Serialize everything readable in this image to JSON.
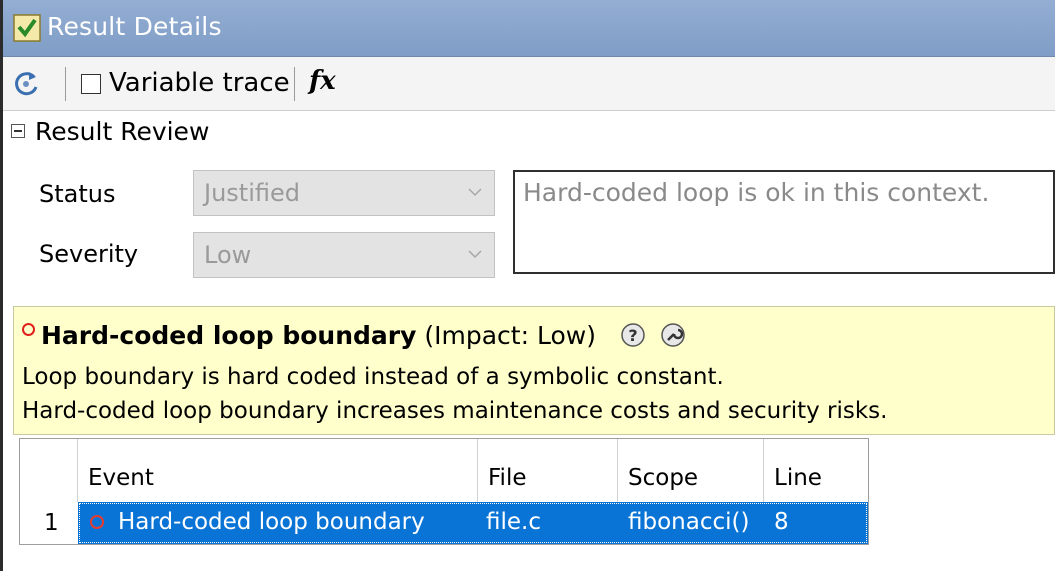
{
  "window": {
    "title": "Result Details"
  },
  "toolbar": {
    "refresh_icon": "refresh-icon",
    "variable_trace_label": "Variable trace",
    "variable_trace_checked": false,
    "fx_label": "fx"
  },
  "review": {
    "section_label": "Result Review",
    "status_label": "Status",
    "status_value": "Justified",
    "severity_label": "Severity",
    "severity_value": "Low",
    "comment": "Hard-coded loop is ok in this context."
  },
  "info": {
    "title": "Hard-coded loop boundary",
    "impact": "(Impact: Low)",
    "description_1": "Loop boundary is hard coded instead of a symbolic constant.",
    "description_2": "Hard-coded loop boundary increases maintenance costs and security risks.",
    "icons": [
      "help-icon",
      "wrench-icon"
    ]
  },
  "events_table": {
    "columns": [
      "",
      "Event",
      "File",
      "Scope",
      "Line"
    ],
    "rows": [
      {
        "index": "1",
        "event": "Hard-coded loop boundary",
        "file": "file.c",
        "scope": "fibonacci()",
        "line": "8"
      }
    ],
    "selection_color": "#0a74d6"
  },
  "colors": {
    "titlebar": "#8aa5cc",
    "info_background": "#ffffcc",
    "defect_ring": "#e0201a"
  }
}
